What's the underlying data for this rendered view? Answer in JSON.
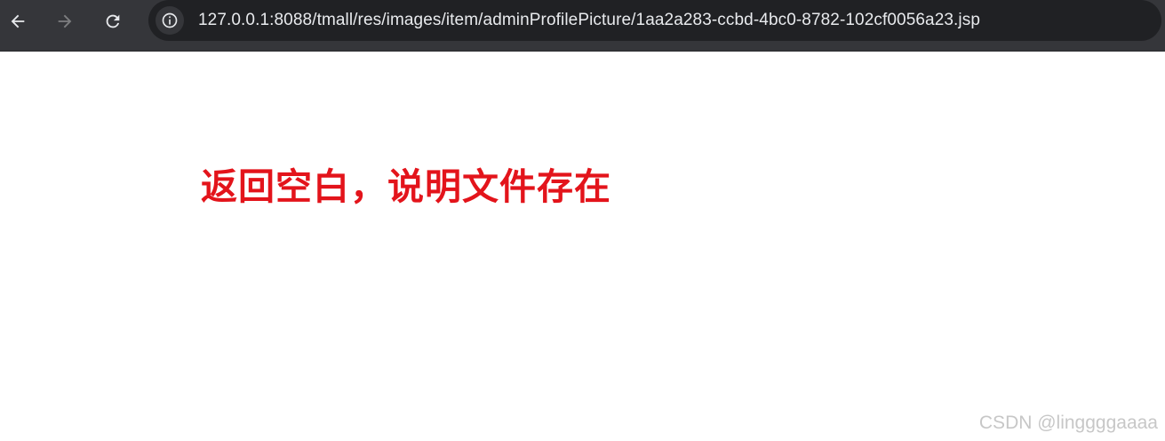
{
  "browser": {
    "url_host": "127.0.0.1",
    "url_rest": ":8088/tmall/res/images/item/adminProfilePicture/1aa2a283-ccbd-4bc0-8782-102cf0056a23.jsp",
    "icons": {
      "back": "arrow-left-icon",
      "forward": "arrow-right-icon",
      "reload": "reload-icon",
      "site_info": "info-icon"
    }
  },
  "page": {
    "annotation": "返回空白，说明文件存在",
    "annotation_color": "#e3141b",
    "watermark": "CSDN @linggggaaaa"
  }
}
